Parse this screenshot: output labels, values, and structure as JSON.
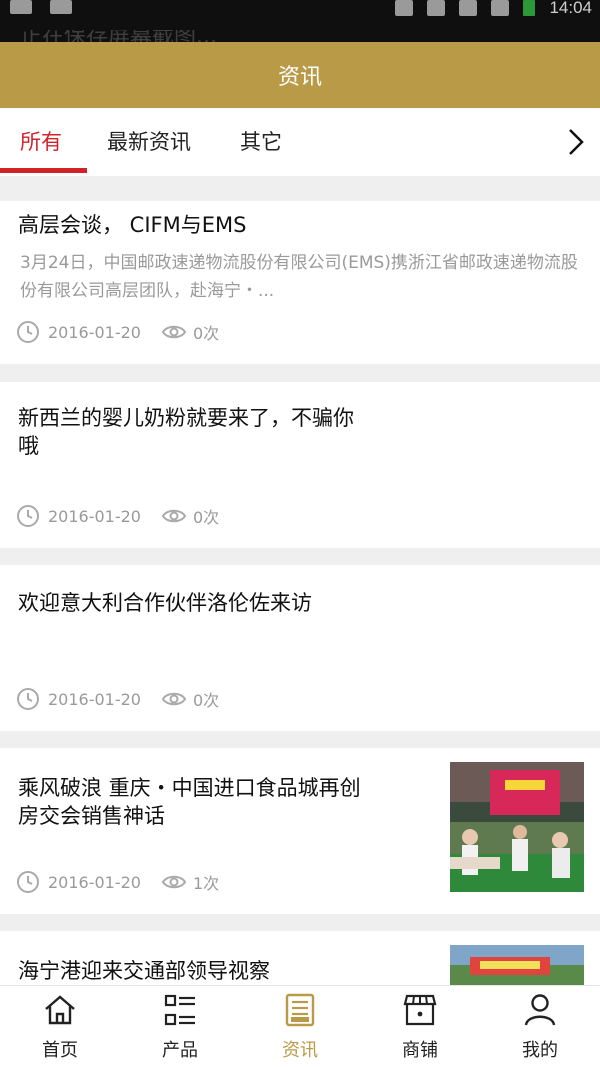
{
  "status_bar": {
    "time": "14:04",
    "notification": "正在保存屏幕截图..."
  },
  "header": {
    "title": "资讯"
  },
  "tabs": [
    {
      "label": "所有",
      "active": true
    },
    {
      "label": "最新资讯",
      "active": false
    },
    {
      "label": "其它",
      "active": false
    }
  ],
  "tabs_more_icon": "chevron-right-icon",
  "articles": [
    {
      "title": "高层会谈， CIFM与EMS",
      "summary": "3月24日，中国邮政速递物流股份有限公司(EMS)携浙江省邮政速递物流股份有限公司高层团队，赴海宁・...",
      "date": "2016-01-20",
      "views": "0次",
      "has_image": false
    },
    {
      "title": "新西兰的婴儿奶粉就要来了，不骗你哦",
      "title_line1": "新西兰的婴儿奶粉就要来了，不骗你",
      "title_line2": "哦",
      "summary": "",
      "date": "2016-01-20",
      "views": "0次",
      "has_image": false
    },
    {
      "title": "欢迎意大利合作伙伴洛伦佐来访",
      "summary": "",
      "date": "2016-01-20",
      "views": "0次",
      "has_image": false
    },
    {
      "title": "乘风破浪 重庆・中国进口食品城再创房交会销售神话",
      "title_line1": "乘风破浪 重庆・中国进口食品城再创",
      "title_line2": "房交会销售神话",
      "summary": "",
      "date": "2016-01-20",
      "views": "1次",
      "has_image": true
    },
    {
      "title": "海宁港迎来交通部领导视察",
      "summary": "",
      "has_image": true
    }
  ],
  "bottom_nav": [
    {
      "label": "首页",
      "icon": "home-icon",
      "active": false
    },
    {
      "label": "产品",
      "icon": "list-icon",
      "active": false
    },
    {
      "label": "资讯",
      "icon": "news-icon",
      "active": true
    },
    {
      "label": "商铺",
      "icon": "shop-icon",
      "active": false
    },
    {
      "label": "我的",
      "icon": "user-icon",
      "active": false
    }
  ],
  "colors": {
    "accent": "#b99a47",
    "tab_active": "#d1222a",
    "muted_text": "#9a9a9a"
  }
}
